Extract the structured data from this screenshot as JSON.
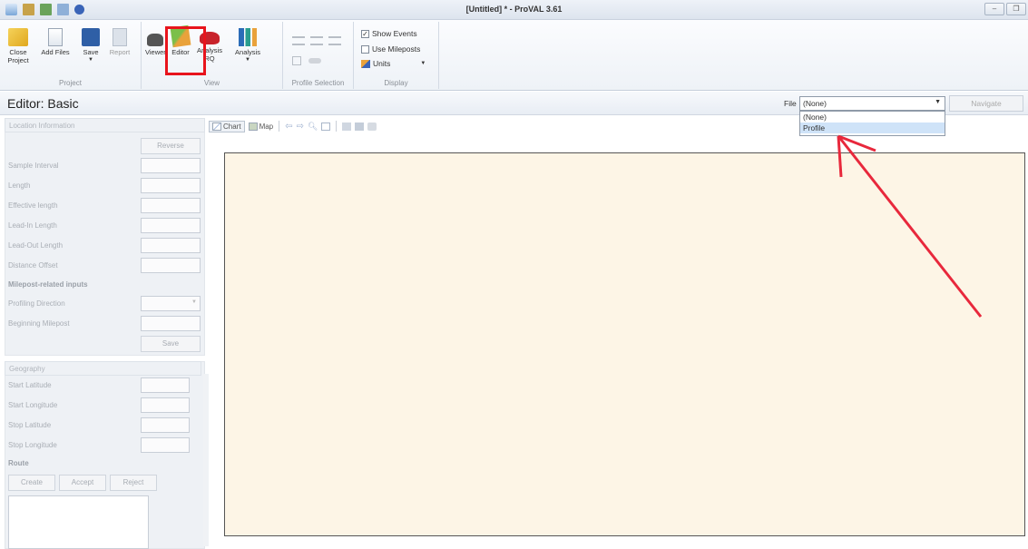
{
  "window": {
    "title": "[Untitled] * - ProVAL 3.61"
  },
  "ribbon": {
    "project": {
      "label": "Project",
      "close": "Close\nProject",
      "add_files": "Add Files",
      "save": "Save",
      "report": "Report"
    },
    "view": {
      "label": "View",
      "viewer": "Viewer",
      "editor": "Editor",
      "analysis_rq": "Analysis\nRQ",
      "analysis": "Analysis"
    },
    "profile_selection": {
      "label": "Profile Selection"
    },
    "display": {
      "label": "Display",
      "show_events": "Show Events",
      "use_mileposts": "Use Mileposts",
      "units": "Units"
    }
  },
  "editor": {
    "title": "Editor: Basic",
    "file_label": "File",
    "file_value": "(None)",
    "navigate": "Navigate",
    "dropdown_options": [
      "(None)",
      "Profile"
    ]
  },
  "left_panel": {
    "location_header": "Location Information",
    "reverse": "Reverse",
    "fields": [
      "Sample Interval",
      "Length",
      "Effective length",
      "Lead-In Length",
      "Lead-Out Length",
      "Distance Offset"
    ],
    "milepost_header": "Milepost-related inputs",
    "profiling_direction": "Profiling Direction",
    "beginning_milepost": "Beginning Milepost",
    "save": "Save",
    "geography_header": "Geography",
    "geo_fields": [
      "Start Latitude",
      "Start Longitude",
      "Stop Latitude",
      "Stop Longitude"
    ],
    "route_label": "Route",
    "create": "Create",
    "accept": "Accept",
    "reject": "Reject"
  },
  "chart_toolbar": {
    "chart": "Chart",
    "map": "Map"
  },
  "colors": {
    "canvas_bg": "#fdf5e6",
    "highlight": "#e8141c",
    "annotation_arrow": "#e8283c"
  }
}
